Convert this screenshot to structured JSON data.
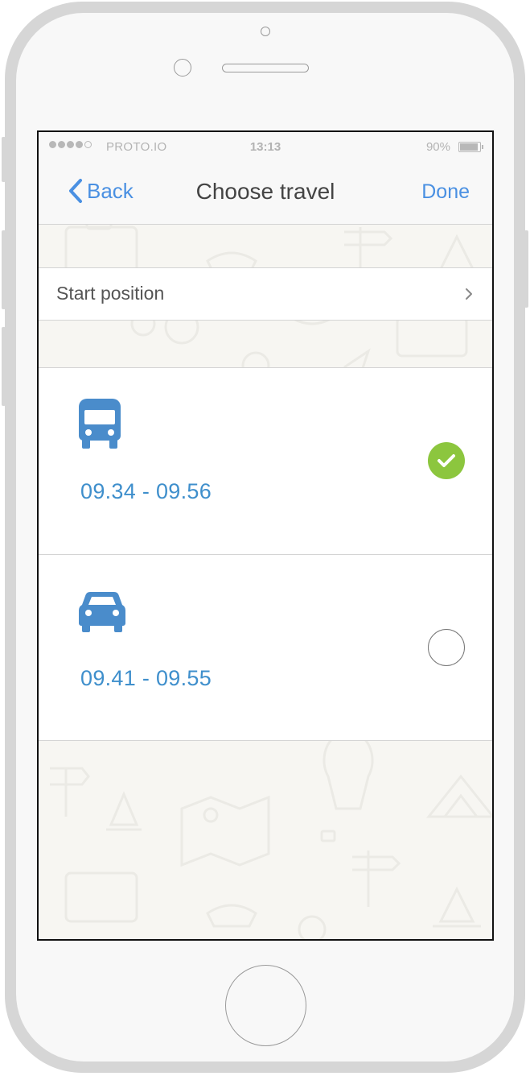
{
  "status_bar": {
    "carrier": "PROTO.IO",
    "time": "13:13",
    "battery": "90%"
  },
  "nav": {
    "back_label": "Back",
    "title": "Choose travel",
    "done_label": "Done"
  },
  "start_row": {
    "label": "Start position",
    "chevron": "chevron-right-icon"
  },
  "options": [
    {
      "icon": "bus-icon",
      "time": "09.34 - 09.56",
      "selected": true
    },
    {
      "icon": "car-icon",
      "time": "09.41 - 09.55",
      "selected": false
    }
  ],
  "colors": {
    "accent": "#4a90e2",
    "time_text": "#3f8fcc",
    "selected_check": "#8cc63e",
    "icon_blue": "#4a8ccb"
  }
}
